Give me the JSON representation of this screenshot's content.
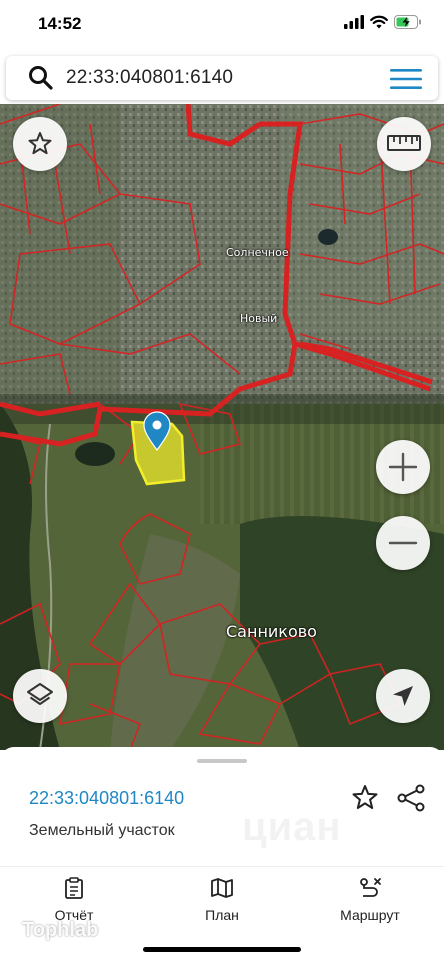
{
  "status": {
    "time": "14:52"
  },
  "search": {
    "query": "22:33:040801:6140"
  },
  "map": {
    "labels": {
      "solnechnoe": "Солнечное",
      "novyi": "Новый",
      "sannikovo": "Санниково"
    },
    "buttons": {
      "favorite": "star-icon",
      "ruler": "ruler-icon",
      "zoom_in": "plus-icon",
      "zoom_out": "minus-icon",
      "layers": "layers-icon",
      "locate": "navigation-arrow-icon"
    },
    "colors": {
      "boundary": "#d82222",
      "selected_parcel": "#f2ee2a",
      "pin": "#1f87c4"
    }
  },
  "sheet": {
    "cadastral_number": "22:33:040801:6140",
    "object_type": "Земельный участок",
    "watermark": "циан"
  },
  "tabs": [
    {
      "label": "Отчёт",
      "icon": "report-icon"
    },
    {
      "label": "План",
      "icon": "map-icon"
    },
    {
      "label": "Маршрут",
      "icon": "route-icon"
    }
  ],
  "corner_watermark": "Tophlab"
}
